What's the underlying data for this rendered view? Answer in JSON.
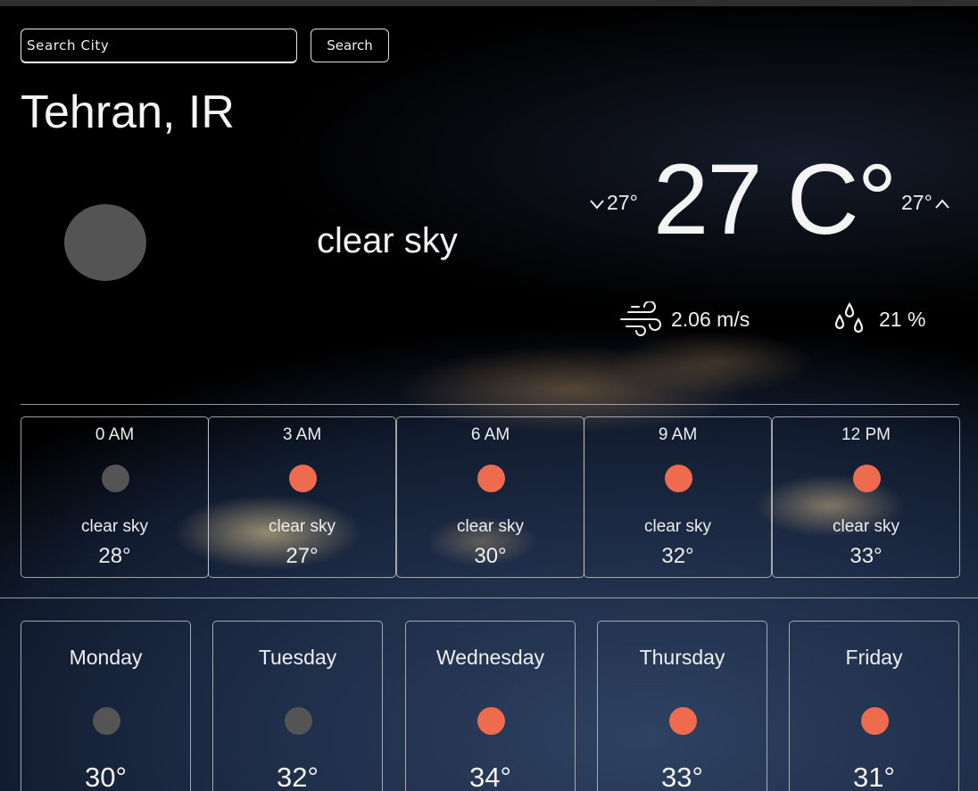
{
  "search": {
    "placeholder": "Search City",
    "button_label": "Search"
  },
  "current": {
    "city": "Tehran, IR",
    "condition": "clear sky",
    "temp_main": "27 C°",
    "temp_min": "27°",
    "temp_max": "27°",
    "icon": "moon-icon",
    "wind": "2.06 m/s",
    "humidity": "21 %"
  },
  "colors": {
    "sun": "#ee6c4d",
    "moon": "#545454"
  },
  "hourly": [
    {
      "time": "0 AM",
      "desc": "clear sky",
      "temp": "28°",
      "icon": "moon-icon"
    },
    {
      "time": "3 AM",
      "desc": "clear sky",
      "temp": "27°",
      "icon": "sun-icon"
    },
    {
      "time": "6 AM",
      "desc": "clear sky",
      "temp": "30°",
      "icon": "sun-icon"
    },
    {
      "time": "9 AM",
      "desc": "clear sky",
      "temp": "32°",
      "icon": "sun-icon"
    },
    {
      "time": "12 PM",
      "desc": "clear sky",
      "temp": "33°",
      "icon": "sun-icon"
    }
  ],
  "daily": [
    {
      "day": "Monday",
      "temp": "30°",
      "icon": "moon-icon"
    },
    {
      "day": "Tuesday",
      "temp": "32°",
      "icon": "moon-icon"
    },
    {
      "day": "Wednesday",
      "temp": "34°",
      "icon": "sun-icon"
    },
    {
      "day": "Thursday",
      "temp": "33°",
      "icon": "sun-icon"
    },
    {
      "day": "Friday",
      "temp": "31°",
      "icon": "sun-icon"
    }
  ]
}
